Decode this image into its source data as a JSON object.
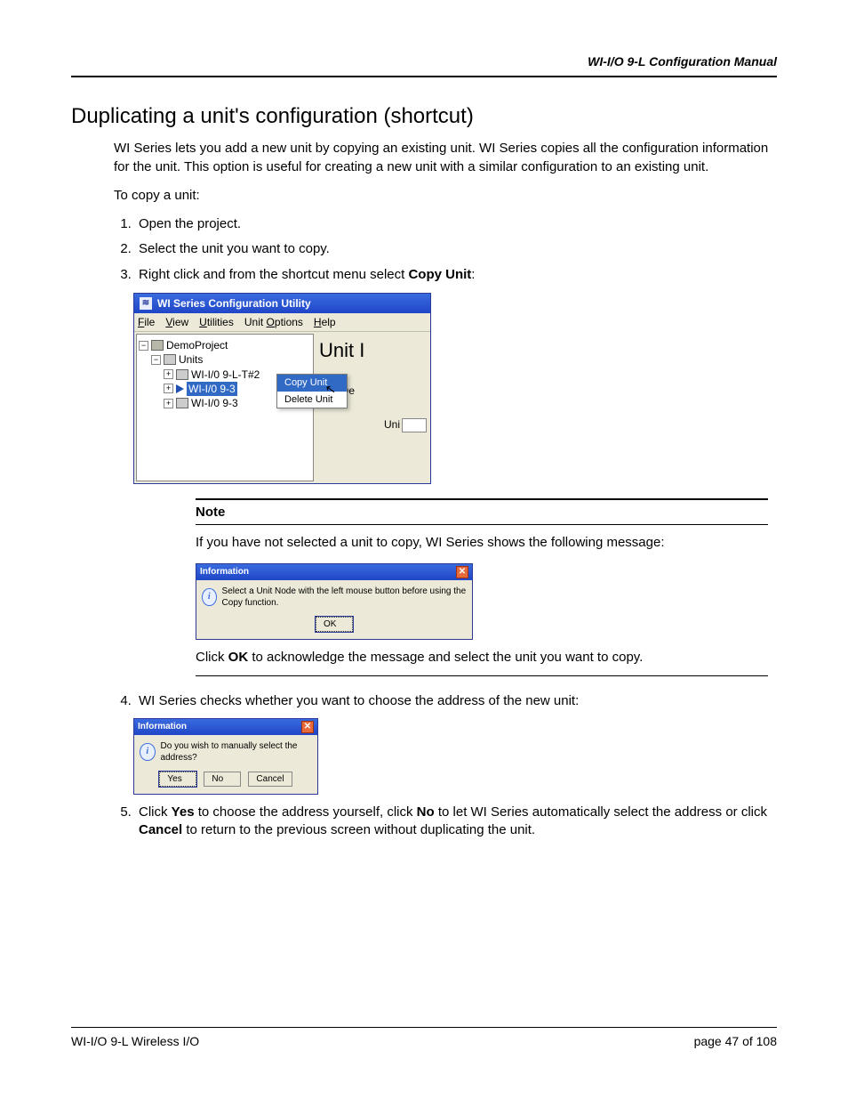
{
  "header": {
    "doc_title": "WI-I/O 9-L Configuration Manual"
  },
  "heading": "Duplicating a unit's configuration (shortcut)",
  "intro": "WI Series lets you add a new unit by copying an existing unit. WI Series copies all the configuration information for the unit. This option is useful for creating a new unit with a similar configuration to an existing unit.",
  "lead": "To copy a unit:",
  "steps": {
    "s1": "Open the project.",
    "s2": "Select the unit you want to copy.",
    "s3_a": "Right click and from the shortcut menu select ",
    "s3_b": "Copy Unit",
    "s3_c": ":",
    "s4": "WI Series checks whether you want to choose the address of the new unit:",
    "s5_a": "Click ",
    "s5_yes": "Yes",
    "s5_b": " to choose the address yourself, click ",
    "s5_no": "No",
    "s5_c": " to let WI Series automatically select the address or click ",
    "s5_cancel": "Cancel",
    "s5_d": " to return to the previous screen without duplicating the unit."
  },
  "app": {
    "title": "WI Series Configuration Utility",
    "menu": {
      "file": "File",
      "view": "View",
      "utilities": "Utilities",
      "unit_options": "Unit Options",
      "help": "Help"
    },
    "tree": {
      "root": "DemoProject",
      "units": "Units",
      "u1": "WI-I/0 9-L-T#2",
      "u2": "WI-I/0 9-3",
      "u3": "WI-I/0 9-3"
    },
    "ctx": {
      "copy": "Copy Unit",
      "delete": "Delete Unit"
    },
    "right": {
      "title": "Unit I",
      "label1": "Unit De",
      "label2": "Uni"
    }
  },
  "note": {
    "title": "Note",
    "text": "If you have not selected a unit to copy, WI Series shows the following message:",
    "after_a": "Click ",
    "after_b": "OK",
    "after_c": " to acknowledge the message and select the unit you want to copy."
  },
  "dlg1": {
    "title": "Information",
    "msg": "Select a Unit Node with the left mouse button before using the Copy function.",
    "ok": "OK"
  },
  "dlg2": {
    "title": "Information",
    "msg": "Do you wish to manually select the address?",
    "yes": "Yes",
    "no": "No",
    "cancel": "Cancel"
  },
  "footer": {
    "left": "WI-I/O 9-L Wireless I/O",
    "right_a": "page ",
    "right_b": "47 of 108"
  }
}
